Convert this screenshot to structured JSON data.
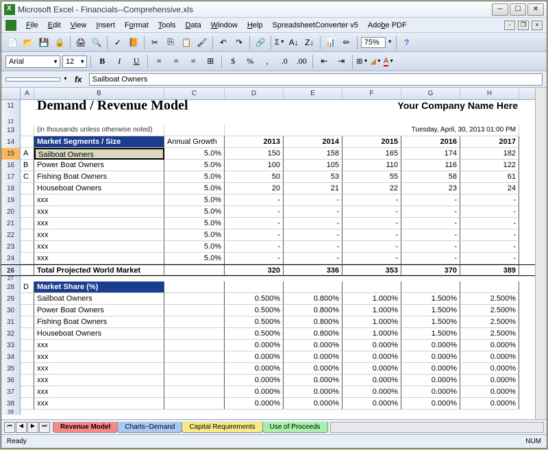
{
  "window": {
    "title": "Microsoft Excel - Financials--Comprehensive.xls"
  },
  "menus": [
    "File",
    "Edit",
    "View",
    "Insert",
    "Format",
    "Tools",
    "Data",
    "Window",
    "Help",
    "SpreadsheetConverter v5",
    "Adobe PDF"
  ],
  "zoom": "75%",
  "font": {
    "name": "Arial",
    "size": "12"
  },
  "formula_bar": {
    "fx": "fx",
    "value": "Sailboat Owners"
  },
  "columns": [
    "A",
    "B",
    "C",
    "D",
    "E",
    "F",
    "G",
    "H"
  ],
  "rows_visible": [
    "11",
    "12",
    "13",
    "14",
    "15",
    "16",
    "17",
    "18",
    "19",
    "20",
    "21",
    "22",
    "23",
    "24",
    "26",
    "27",
    "28",
    "29",
    "30",
    "31",
    "32",
    "33",
    "34",
    "35",
    "36",
    "37",
    "38",
    "39"
  ],
  "title": "Demand / Revenue Model",
  "company": "Your Company Name Here",
  "subtitle": "(in thousands unless otherwise noted)",
  "timestamp": "Tuesday, April, 30, 2013 01:00 PM",
  "headers": {
    "segments": "Market Segments / Size",
    "growth": "Annual Growth",
    "years": [
      "2013",
      "2014",
      "2015",
      "2016",
      "2017"
    ],
    "share": "Market Share (%)"
  },
  "row_labels": {
    "a": "A",
    "b": "B",
    "c": "C",
    "d": "D"
  },
  "segments": [
    {
      "label": "Sailboat Owners",
      "growth": "5.0%",
      "vals": [
        "150",
        "158",
        "165",
        "174",
        "182"
      ]
    },
    {
      "label": "Power Boat Owners",
      "growth": "5.0%",
      "vals": [
        "100",
        "105",
        "110",
        "116",
        "122"
      ]
    },
    {
      "label": "Fishing Boat Owners",
      "growth": "5.0%",
      "vals": [
        "50",
        "53",
        "55",
        "58",
        "61"
      ]
    },
    {
      "label": "Houseboat Owners",
      "growth": "5.0%",
      "vals": [
        "20",
        "21",
        "22",
        "23",
        "24"
      ]
    },
    {
      "label": "xxx",
      "growth": "5.0%",
      "vals": [
        "-",
        "-",
        "-",
        "-",
        "-"
      ]
    },
    {
      "label": "xxx",
      "growth": "5.0%",
      "vals": [
        "-",
        "-",
        "-",
        "-",
        "-"
      ]
    },
    {
      "label": "xxx",
      "growth": "5.0%",
      "vals": [
        "-",
        "-",
        "-",
        "-",
        "-"
      ]
    },
    {
      "label": "xxx",
      "growth": "5.0%",
      "vals": [
        "-",
        "-",
        "-",
        "-",
        "-"
      ]
    },
    {
      "label": "xxx",
      "growth": "5.0%",
      "vals": [
        "-",
        "-",
        "-",
        "-",
        "-"
      ]
    },
    {
      "label": "xxx",
      "growth": "5.0%",
      "vals": [
        "-",
        "-",
        "-",
        "-",
        "-"
      ]
    }
  ],
  "total": {
    "label": "Total Projected World Market",
    "vals": [
      "320",
      "336",
      "353",
      "370",
      "389"
    ]
  },
  "share": [
    {
      "label": "Sailboat Owners",
      "vals": [
        "0.500%",
        "0.800%",
        "1.000%",
        "1.500%",
        "2.500%"
      ]
    },
    {
      "label": "Power Boat Owners",
      "vals": [
        "0.500%",
        "0.800%",
        "1.000%",
        "1.500%",
        "2.500%"
      ]
    },
    {
      "label": "Fishing Boat Owners",
      "vals": [
        "0.500%",
        "0.800%",
        "1.000%",
        "1.500%",
        "2.500%"
      ]
    },
    {
      "label": "Houseboat Owners",
      "vals": [
        "0.500%",
        "0.800%",
        "1.000%",
        "1.500%",
        "2.500%"
      ]
    },
    {
      "label": "xxx",
      "vals": [
        "0.000%",
        "0.000%",
        "0.000%",
        "0.000%",
        "0.000%"
      ]
    },
    {
      "label": "xxx",
      "vals": [
        "0.000%",
        "0.000%",
        "0.000%",
        "0.000%",
        "0.000%"
      ]
    },
    {
      "label": "xxx",
      "vals": [
        "0.000%",
        "0.000%",
        "0.000%",
        "0.000%",
        "0.000%"
      ]
    },
    {
      "label": "xxx",
      "vals": [
        "0.000%",
        "0.000%",
        "0.000%",
        "0.000%",
        "0.000%"
      ]
    },
    {
      "label": "xxx",
      "vals": [
        "0.000%",
        "0.000%",
        "0.000%",
        "0.000%",
        "0.000%"
      ]
    },
    {
      "label": "xxx",
      "vals": [
        "0.000%",
        "0.000%",
        "0.000%",
        "0.000%",
        "0.000%"
      ]
    }
  ],
  "tabs": [
    "Revenue Model",
    "Charts~Demand",
    "Capital Requirements",
    "Use of Proceeds"
  ],
  "status": {
    "ready": "Ready",
    "num": "NUM"
  }
}
